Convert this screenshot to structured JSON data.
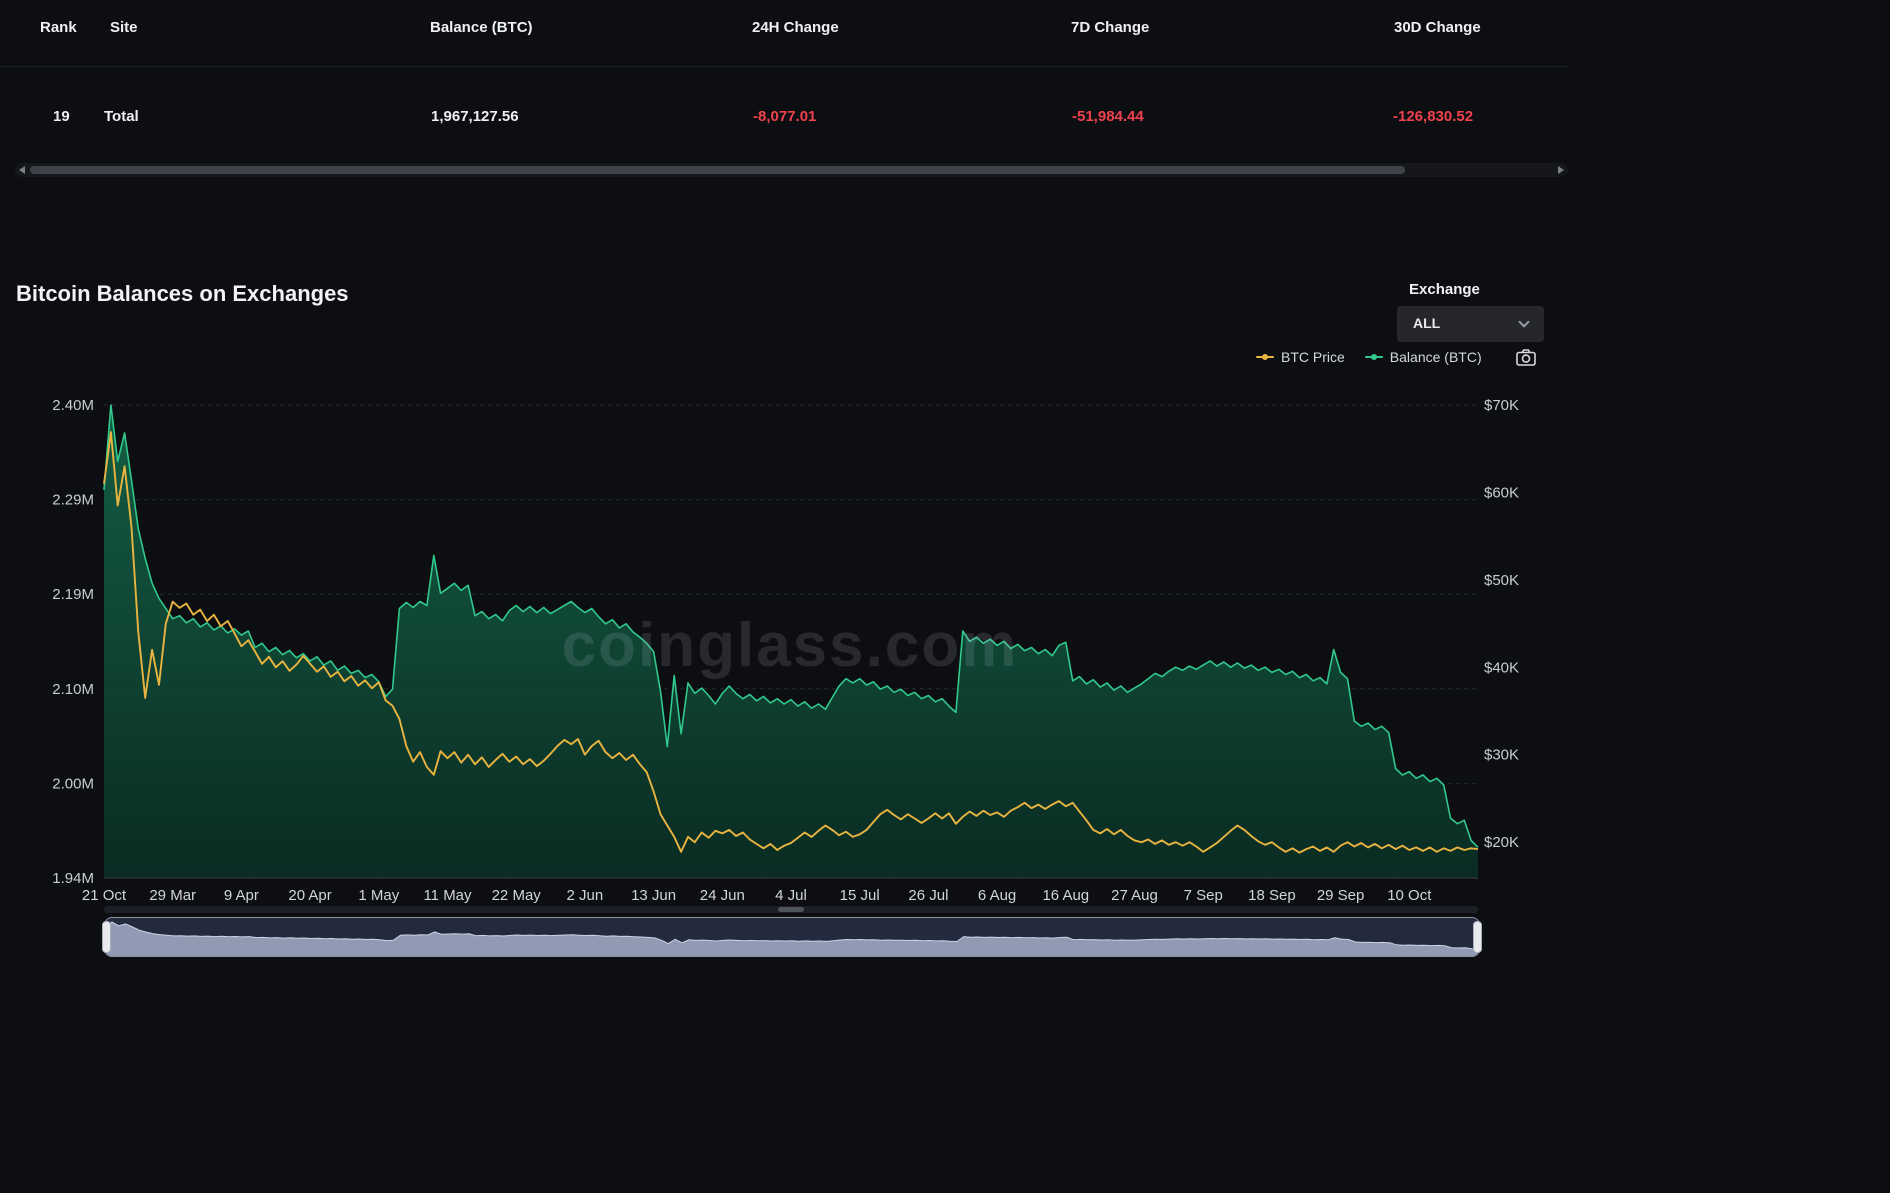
{
  "table": {
    "columns": [
      "Rank",
      "Site",
      "Balance (BTC)",
      "24H Change",
      "7D Change",
      "30D Change"
    ],
    "rows": [
      {
        "rank": "19",
        "site": "Total",
        "balance": "1,967,127.56",
        "change_24h": "-8,077.01",
        "change_7d": "-51,984.44",
        "change_30d": "-126,830.52"
      }
    ],
    "negative_color": "#f0424e"
  },
  "chart_header": {
    "title": "Bitcoin Balances on Exchanges",
    "exchange_label": "Exchange",
    "exchange_value": "ALL",
    "watermark": "coinglass.com",
    "legend": [
      {
        "label": "BTC Price",
        "color": "#e9b440"
      },
      {
        "label": "Balance (BTC)",
        "color": "#31c98e"
      }
    ]
  },
  "chart_data": {
    "type": "area",
    "title": "Bitcoin Balances on Exchanges",
    "grid": "horizontal-dashed",
    "legend_position": "top-right",
    "x_ticks": [
      "21 Oct",
      "29 Mar",
      "9 Apr",
      "20 Apr",
      "1 May",
      "11 May",
      "22 May",
      "2 Jun",
      "13 Jun",
      "24 Jun",
      "4 Jul",
      "15 Jul",
      "26 Jul",
      "6 Aug",
      "16 Aug",
      "27 Aug",
      "7 Sep",
      "18 Sep",
      "29 Sep",
      "10 Oct"
    ],
    "left_axis": {
      "title": "Balance (BTC)",
      "unit": "million BTC",
      "scale": "log",
      "min": 1.94,
      "max": 2.4,
      "tick_labels": [
        "2.40M",
        "2.29M",
        "2.19M",
        "2.10M",
        "2.00M",
        "1.94M"
      ]
    },
    "right_axis": {
      "title": "BTC Price",
      "unit": "thousand USD",
      "scale": "linear",
      "min": 15.9,
      "max": 70,
      "tick_values": [
        70,
        60,
        50,
        40,
        30,
        20
      ],
      "tick_labels": [
        "$70K",
        "$60K",
        "$50K",
        "$40K",
        "$30K",
        "$20K"
      ]
    },
    "series": [
      {
        "name": "Balance (BTC)",
        "type": "area",
        "axis": "left",
        "color": "#31c98e",
        "unit": "million BTC",
        "values": [
          2.31,
          2.4,
          2.34,
          2.37,
          2.32,
          2.27,
          2.24,
          2.215,
          2.2,
          2.19,
          2.18,
          2.183,
          2.176,
          2.18,
          2.172,
          2.176,
          2.169,
          2.173,
          2.166,
          2.17,
          2.164,
          2.168,
          2.152,
          2.156,
          2.148,
          2.152,
          2.145,
          2.149,
          2.142,
          2.146,
          2.139,
          2.143,
          2.135,
          2.139,
          2.13,
          2.134,
          2.127,
          2.13,
          2.123,
          2.126,
          2.119,
          2.105,
          2.112,
          2.19,
          2.196,
          2.191,
          2.197,
          2.193,
          2.243,
          2.205,
          2.21,
          2.215,
          2.208,
          2.213,
          2.183,
          2.187,
          2.18,
          2.184,
          2.178,
          2.188,
          2.193,
          2.187,
          2.192,
          2.186,
          2.191,
          2.185,
          2.189,
          2.193,
          2.197,
          2.191,
          2.186,
          2.19,
          2.182,
          2.175,
          2.179,
          2.171,
          2.175,
          2.167,
          2.162,
          2.156,
          2.148,
          2.11,
          2.058,
          2.125,
          2.07,
          2.118,
          2.108,
          2.113,
          2.106,
          2.098,
          2.108,
          2.115,
          2.108,
          2.103,
          2.107,
          2.101,
          2.105,
          2.099,
          2.103,
          2.098,
          2.102,
          2.096,
          2.1,
          2.094,
          2.098,
          2.093,
          2.104,
          2.115,
          2.122,
          2.118,
          2.122,
          2.116,
          2.119,
          2.112,
          2.115,
          2.109,
          2.112,
          2.106,
          2.109,
          2.103,
          2.106,
          2.1,
          2.103,
          2.096,
          2.09,
          2.168,
          2.158,
          2.162,
          2.156,
          2.16,
          2.154,
          2.158,
          2.151,
          2.155,
          2.149,
          2.152,
          2.146,
          2.15,
          2.144,
          2.154,
          2.157,
          2.12,
          2.124,
          2.117,
          2.121,
          2.114,
          2.118,
          2.111,
          2.115,
          2.109,
          2.113,
          2.117,
          2.122,
          2.127,
          2.124,
          2.129,
          2.133,
          2.13,
          2.134,
          2.131,
          2.135,
          2.139,
          2.134,
          2.138,
          2.133,
          2.137,
          2.132,
          2.135,
          2.13,
          2.133,
          2.128,
          2.131,
          2.126,
          2.129,
          2.123,
          2.126,
          2.12,
          2.123,
          2.117,
          2.15,
          2.128,
          2.122,
          2.082,
          2.077,
          2.08,
          2.074,
          2.077,
          2.071,
          2.038,
          2.032,
          2.035,
          2.029,
          2.032,
          2.026,
          2.029,
          2.023,
          1.993,
          1.988,
          1.991,
          1.973,
          1.967
        ]
      },
      {
        "name": "BTC Price",
        "type": "line",
        "axis": "right",
        "color": "#e9b440",
        "unit": "thousand USD",
        "values": [
          61.0,
          66.9,
          58.5,
          63.0,
          56.0,
          44.0,
          36.5,
          42.0,
          38.0,
          45.0,
          47.5,
          46.8,
          47.3,
          46.0,
          46.6,
          45.3,
          46.0,
          44.7,
          45.3,
          43.9,
          42.4,
          43.1,
          41.8,
          40.4,
          41.2,
          40.0,
          40.7,
          39.6,
          40.3,
          41.3,
          40.4,
          39.5,
          40.1,
          38.9,
          39.5,
          38.4,
          39.0,
          37.9,
          38.5,
          37.6,
          38.3,
          36.2,
          35.6,
          34.1,
          31.0,
          29.2,
          30.3,
          28.6,
          27.7,
          30.4,
          29.6,
          30.3,
          29.1,
          30.0,
          28.9,
          29.7,
          28.6,
          29.4,
          30.1,
          29.2,
          29.8,
          28.9,
          29.5,
          28.7,
          29.3,
          30.1,
          31.0,
          31.7,
          31.2,
          31.8,
          30.0,
          31.0,
          31.6,
          30.3,
          29.6,
          30.2,
          29.4,
          30.0,
          28.9,
          28.0,
          25.8,
          23.2,
          21.9,
          20.6,
          18.9,
          20.6,
          20.0,
          21.1,
          20.5,
          21.3,
          21.0,
          21.4,
          20.7,
          21.1,
          20.3,
          19.8,
          19.3,
          19.8,
          19.1,
          19.6,
          19.9,
          20.5,
          21.1,
          20.6,
          21.3,
          21.9,
          21.4,
          20.8,
          21.2,
          20.6,
          20.9,
          21.4,
          22.3,
          23.2,
          23.7,
          23.1,
          22.6,
          23.2,
          22.7,
          22.2,
          22.7,
          23.3,
          22.7,
          23.3,
          22.1,
          22.9,
          23.5,
          23.0,
          23.6,
          23.1,
          23.4,
          22.9,
          23.6,
          24.0,
          24.5,
          23.9,
          24.3,
          23.8,
          24.3,
          24.7,
          24.1,
          24.5,
          23.5,
          22.5,
          21.4,
          21.0,
          21.5,
          20.9,
          21.4,
          20.7,
          20.2,
          20.0,
          20.3,
          19.8,
          20.2,
          19.7,
          20.0,
          19.6,
          20.0,
          19.5,
          18.9,
          19.4,
          19.9,
          20.6,
          21.3,
          21.9,
          21.4,
          20.7,
          20.1,
          19.7,
          20.0,
          19.4,
          18.9,
          19.3,
          18.8,
          19.2,
          19.5,
          19.0,
          19.4,
          18.9,
          19.6,
          20.0,
          19.5,
          19.9,
          19.4,
          19.8,
          19.3,
          19.7,
          19.2,
          19.6,
          19.1,
          19.4,
          19.0,
          19.4,
          18.9,
          19.3,
          19.0,
          19.4,
          19.1,
          19.3,
          19.2
        ]
      }
    ]
  }
}
